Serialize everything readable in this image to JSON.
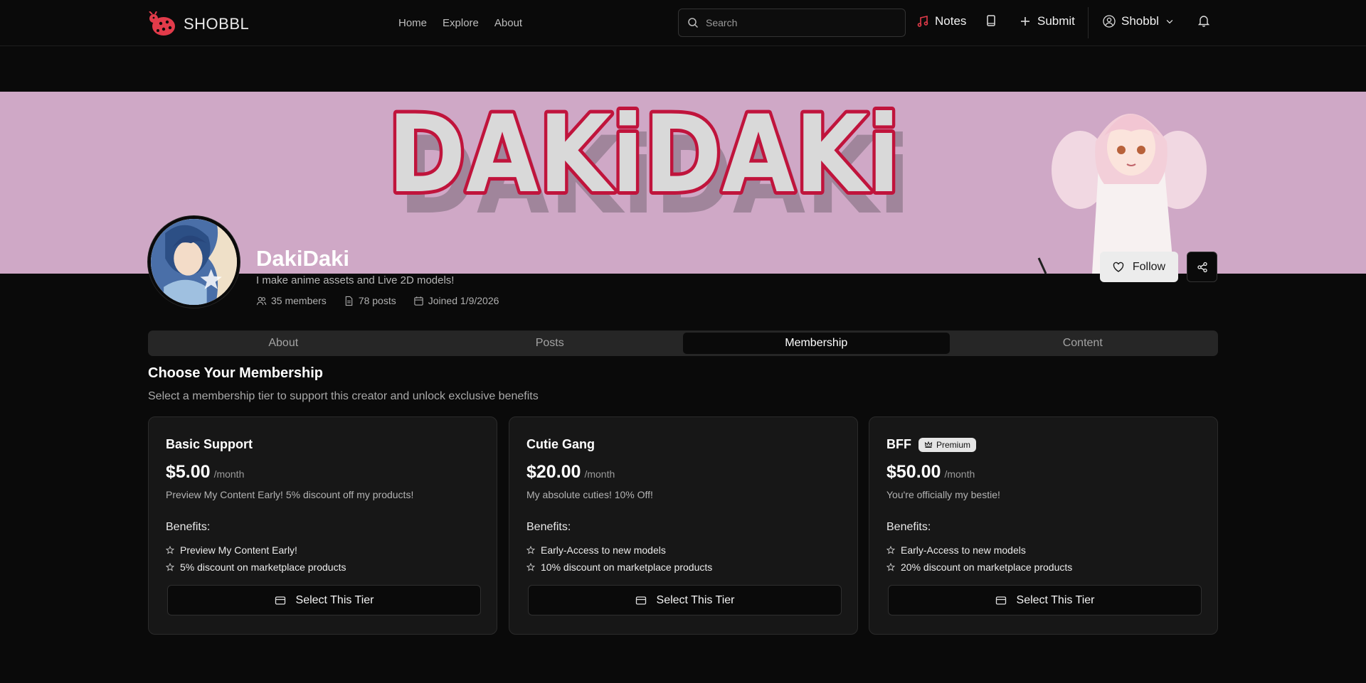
{
  "header": {
    "logo_text": "SHOBBL",
    "nav": [
      "Home",
      "Explore",
      "About"
    ],
    "search_placeholder": "Search",
    "notes_label": "Notes",
    "submit_label": "Submit",
    "user_label": "Shobbl",
    "icons": {
      "search": "search-icon",
      "notes": "music-note-icon",
      "library": "book-icon",
      "submit": "plus-icon",
      "user": "user-icon",
      "dropdown": "chevron-down-icon",
      "notifications": "bell-icon"
    },
    "accent_color": "#e23b4a"
  },
  "banner": {
    "text": "DAKiDAKi",
    "background_color": "#cfa8c6",
    "lettering_outline_color": "#c0143c"
  },
  "profile": {
    "name": "DakiDaki",
    "bio": "I make anime assets and Live 2D models!",
    "members": "35 members",
    "posts": "78 posts",
    "joined": "Joined 1/9/2026",
    "follow_label": "Follow"
  },
  "tabs": [
    {
      "label": "About",
      "active": false
    },
    {
      "label": "Posts",
      "active": false
    },
    {
      "label": "Membership",
      "active": true
    },
    {
      "label": "Content",
      "active": false
    }
  ],
  "membership": {
    "title": "Choose Your Membership",
    "subtitle": "Select a membership tier to support this creator and unlock exclusive benefits",
    "benefits_heading": "Benefits:",
    "select_label": "Select This Tier",
    "tiers": [
      {
        "name": "Basic Support",
        "price": "$5.00",
        "period": "/month",
        "description": "Preview My Content Early! 5% discount off my products!",
        "badge": "",
        "benefits": [
          "Preview My Content Early!",
          "5% discount on marketplace products"
        ]
      },
      {
        "name": "Cutie Gang",
        "price": "$20.00",
        "period": "/month",
        "description": "My absolute cuties! 10% Off!",
        "badge": "",
        "benefits": [
          "Early-Access to new models",
          "10% discount on marketplace products"
        ]
      },
      {
        "name": "BFF",
        "price": "$50.00",
        "period": "/month",
        "description": "You're officially my bestie!",
        "badge": "Premium",
        "benefits": [
          "Early-Access to new models",
          "20% discount on marketplace products"
        ]
      }
    ]
  }
}
